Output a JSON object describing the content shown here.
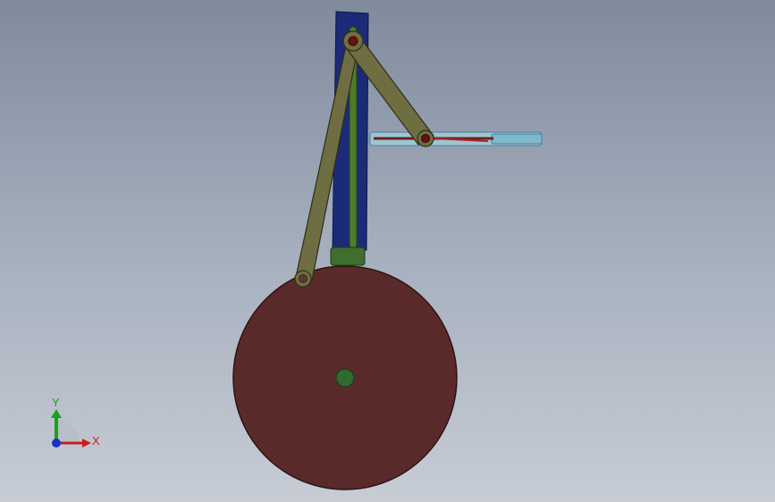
{
  "viewport": {
    "background_top": "#7f8b9d",
    "background_bottom": "#c7ccd5"
  },
  "model": {
    "parts": [
      "frame-slot",
      "vertical-slider",
      "long-link",
      "short-link",
      "horizontal-cylinder",
      "piston-rod",
      "wheel",
      "wheel-hub"
    ],
    "colors": {
      "frame": "#1c2b78",
      "slider": "#4e7c2a",
      "link": "#6f6d42",
      "link_outline": "#2f2e18",
      "wheel": "#5a2a2a",
      "hub": "#2f6a30",
      "cylinder": "#8fc6d6",
      "rod": "#7a1a1a",
      "pin": "#6b1010"
    }
  },
  "triad": {
    "x_label": "X",
    "y_label": "Y",
    "x_color": "#c81e1e",
    "y_color": "#1aa21a",
    "z_color": "#1f2fc8"
  }
}
